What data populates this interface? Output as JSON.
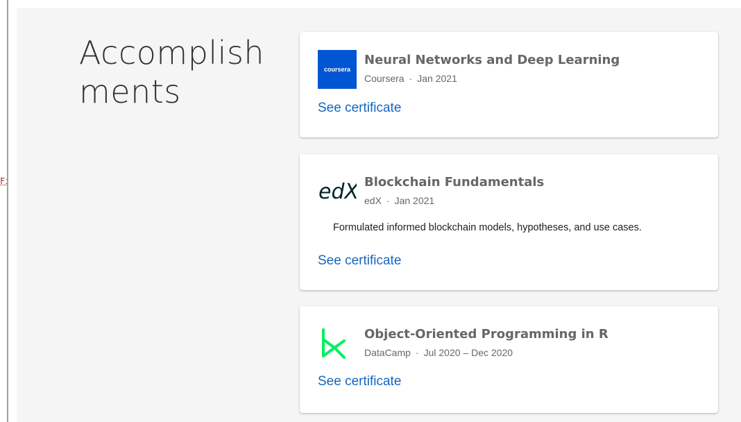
{
  "sidebar": {
    "clipped_text": "Fig"
  },
  "section": {
    "title": "Accomplishments"
  },
  "accomplishments": [
    {
      "title": "Neural Networks and Deep Learning",
      "issuer": "Coursera",
      "date": "Jan 2021",
      "description": "",
      "link_label": "See certificate",
      "logo_icon": "coursera-logo-icon",
      "logo_text": "coursera",
      "logo_color": "#0056d2"
    },
    {
      "title": "Blockchain Fundamentals",
      "issuer": "edX",
      "date": "Jan 2021",
      "description": "Formulated informed blockchain models, hypotheses, and use cases.",
      "link_label": "See certificate",
      "logo_icon": "edx-logo-icon",
      "logo_text": "edX",
      "logo_color": "#02262b"
    },
    {
      "title": "Object-Oriented Programming in R",
      "issuer": "DataCamp",
      "date": "Jul 2020 – Dec 2020",
      "description": "",
      "link_label": "See certificate",
      "logo_icon": "datacamp-logo-icon",
      "logo_color": "#03ef62"
    }
  ],
  "colors": {
    "link": "#1565c0",
    "section_bg": "#f5f5f5",
    "title_text": "#666666"
  }
}
